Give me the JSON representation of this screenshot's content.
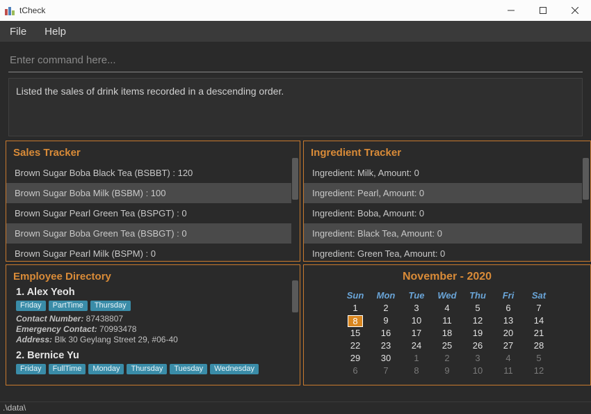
{
  "window": {
    "title": "tCheck"
  },
  "menu": {
    "file": "File",
    "help": "Help"
  },
  "command": {
    "placeholder": "Enter command here..."
  },
  "output": {
    "text": "Listed the sales of drink items recorded in a descending order."
  },
  "sales": {
    "title": "Sales Tracker",
    "items": [
      "Brown Sugar Boba Black Tea (BSBBT) : 120",
      "Brown Sugar Boba Milk (BSBM) : 100",
      "Brown Sugar Pearl Green Tea (BSPGT) : 0",
      "Brown Sugar Boba Green Tea (BSBGT) : 0",
      "Brown Sugar Pearl Milk (BSPM) : 0"
    ]
  },
  "ingredients": {
    "title": "Ingredient Tracker",
    "items": [
      "Ingredient: Milk,  Amount: 0",
      "Ingredient: Pearl,  Amount: 0",
      "Ingredient: Boba,  Amount: 0",
      "Ingredient: Black Tea,  Amount: 0",
      "Ingredient: Green Tea,  Amount: 0"
    ]
  },
  "employees": {
    "title": "Employee Directory",
    "entries": [
      {
        "idx": "1.",
        "name": "Alex Yeoh",
        "tags": [
          "Friday",
          "PartTime",
          "Thursday"
        ],
        "contactLabel": "Contact Number:",
        "contact": "87438807",
        "emergencyLabel": "Emergency Contact:",
        "emergency": "70993478",
        "addressLabel": "Address:",
        "address": "Blk 30 Geylang Street 29, #06-40"
      },
      {
        "idx": "2.",
        "name": "Bernice Yu",
        "tags": [
          "Friday",
          "FullTime",
          "Monday",
          "Thursday",
          "Tuesday",
          "Wednesday"
        ]
      }
    ]
  },
  "calendar": {
    "title": "November - 2020",
    "daysOfWeek": [
      "Sun",
      "Mon",
      "Tue",
      "Wed",
      "Thu",
      "Fri",
      "Sat"
    ],
    "selected": 8,
    "weeks": [
      [
        {
          "n": 1
        },
        {
          "n": 2
        },
        {
          "n": 3
        },
        {
          "n": 4
        },
        {
          "n": 5
        },
        {
          "n": 6
        },
        {
          "n": 7
        }
      ],
      [
        {
          "n": 8,
          "sel": true
        },
        {
          "n": 9
        },
        {
          "n": 10
        },
        {
          "n": 11
        },
        {
          "n": 12
        },
        {
          "n": 13
        },
        {
          "n": 14
        }
      ],
      [
        {
          "n": 15
        },
        {
          "n": 16
        },
        {
          "n": 17
        },
        {
          "n": 18
        },
        {
          "n": 19
        },
        {
          "n": 20
        },
        {
          "n": 21
        }
      ],
      [
        {
          "n": 22
        },
        {
          "n": 23
        },
        {
          "n": 24
        },
        {
          "n": 25
        },
        {
          "n": 26
        },
        {
          "n": 27
        },
        {
          "n": 28
        }
      ],
      [
        {
          "n": 29
        },
        {
          "n": 30
        },
        {
          "n": 1,
          "o": true
        },
        {
          "n": 2,
          "o": true
        },
        {
          "n": 3,
          "o": true
        },
        {
          "n": 4,
          "o": true
        },
        {
          "n": 5,
          "o": true
        }
      ],
      [
        {
          "n": 6,
          "o": true
        },
        {
          "n": 7,
          "o": true
        },
        {
          "n": 8,
          "o": true
        },
        {
          "n": 9,
          "o": true
        },
        {
          "n": 10,
          "o": true
        },
        {
          "n": 11,
          "o": true
        },
        {
          "n": 12,
          "o": true
        }
      ]
    ]
  },
  "statusbar": {
    "text": ".\\data\\"
  }
}
